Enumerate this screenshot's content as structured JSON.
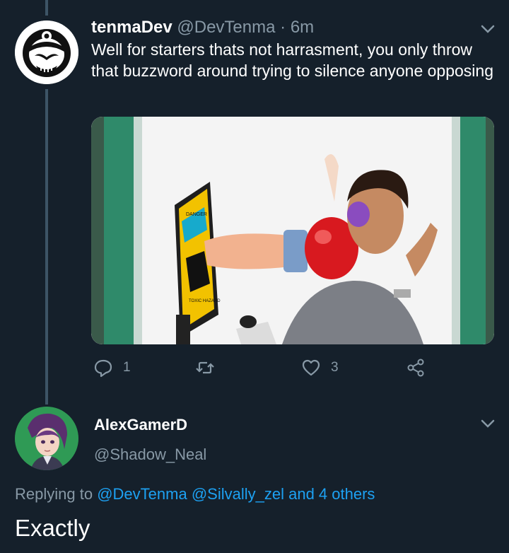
{
  "tweet1": {
    "name": "tenmaDev",
    "handle": "@DevTenma",
    "separator": "·",
    "time": "6m",
    "text": "Well for starters thats not harrasment, you only throw that buzzword around trying to silence anyone opposing",
    "media_image_text": [
      "DANGER",
      "TOXIC HAZARD"
    ],
    "reply_count": "1",
    "retweet_count": "",
    "like_count": "3"
  },
  "tweet2": {
    "name": "AlexGamerD",
    "handle": "@Shadow_Neal",
    "replying_prefix": "Replying to",
    "mention1": "@DevTenma",
    "mention2": "@Silvally_zel",
    "others": "and 4 others",
    "text": "Exactly"
  },
  "colors": {
    "background": "#15202b",
    "muted": "#8899a6",
    "link": "#1da1f2",
    "thread_line": "#3d5466"
  },
  "icons": [
    "chevron-down-icon",
    "reply-icon",
    "retweet-icon",
    "like-icon",
    "share-icon",
    "avatar-mask-icon",
    "avatar-anime-icon"
  ]
}
